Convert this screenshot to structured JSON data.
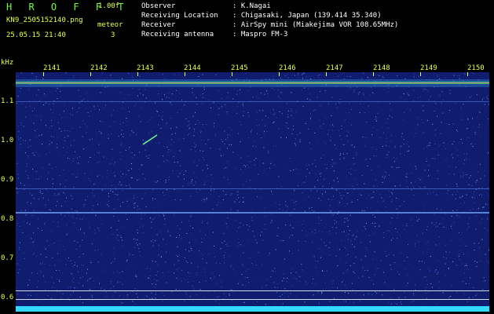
{
  "header": {
    "app_title": "H R O F F T",
    "version": "1.00f",
    "file_name": "KN9_2505152140.png",
    "meteor_label": "meteor",
    "meteor_count": "3",
    "timestamp": "25.05.15 21:40"
  },
  "info": [
    {
      "key": "Observer",
      "value": ": K.Nagai"
    },
    {
      "key": "Receiving Location",
      "value": ": Chigasaki, Japan (139.414 35.340)"
    },
    {
      "key": "Receiver",
      "value": ": AirSpy mini (Miakejima VOR 108.65MHz)"
    },
    {
      "key": "Receiving antenna",
      "value": ": Maspro FM-3"
    }
  ],
  "axis": {
    "y_unit": "kHz",
    "y_ticks": [
      "1.1",
      "1.0",
      "0.9",
      "0.8",
      "0.7",
      "0.6"
    ],
    "x_ticks": [
      "2141",
      "2142",
      "2143",
      "2144",
      "2145",
      "2146",
      "2147",
      "2148",
      "2149",
      "2150"
    ]
  },
  "colors": {
    "label_yellow": "#e8ff4a",
    "title_green": "#6cff3a",
    "background_blue": "#101c6e",
    "noise_floor_cyan": "#33d8ff"
  }
}
